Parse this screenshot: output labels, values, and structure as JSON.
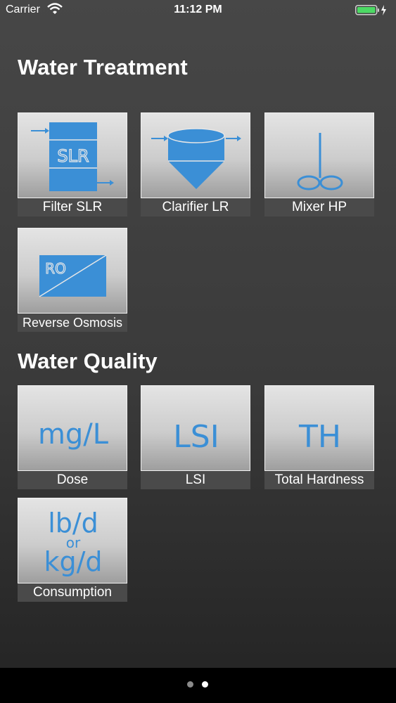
{
  "status_bar": {
    "carrier": "Carrier",
    "time": "11:12 PM"
  },
  "sections": {
    "treatment_title": "Water Treatment",
    "quality_title": "Water Quality"
  },
  "tiles": {
    "filter": {
      "label": "Filter SLR",
      "icon_text": "SLR"
    },
    "clarifier": {
      "label": "Clarifier LR"
    },
    "mixer": {
      "label": "Mixer HP"
    },
    "ro": {
      "label": "Reverse Osmosis",
      "icon_text": "RO"
    },
    "dose": {
      "label": "Dose",
      "icon_text": "mg/L"
    },
    "lsi": {
      "label": "LSI",
      "icon_text": "LSI"
    },
    "hardness": {
      "label": "Total Hardness",
      "icon_text": "TH"
    },
    "consumption": {
      "label": "Consumption",
      "icon_line1": "lb/d",
      "icon_line2": "or",
      "icon_line3": "kg/d"
    }
  },
  "page_indicator": {
    "pages": 2,
    "current": 2
  },
  "colors": {
    "icon_blue": "#3b8fd6",
    "battery_green": "#4cd964"
  }
}
